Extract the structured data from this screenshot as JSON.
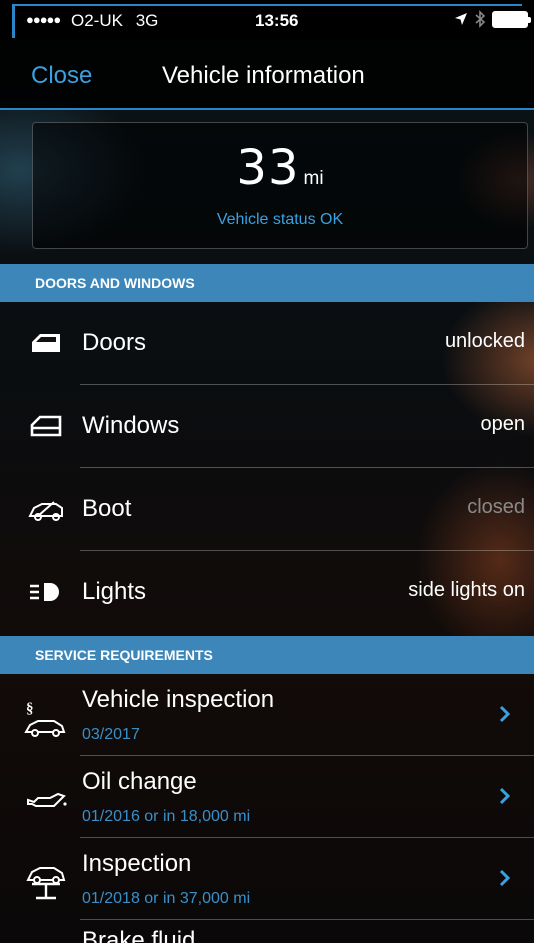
{
  "status_bar": {
    "signal_dots": "●●●●●",
    "carrier": "O2-UK",
    "network": "3G",
    "time": "13:56",
    "location_icon": "location-arrow-icon",
    "bluetooth_icon": "bluetooth-icon",
    "battery_icon": "battery-icon"
  },
  "nav": {
    "close_label": "Close",
    "title": "Vehicle information"
  },
  "vehicle_status": {
    "mileage": "33",
    "unit": "mi",
    "status": "Vehicle status OK"
  },
  "doors_windows": {
    "header": "DOORS AND WINDOWS",
    "items": [
      {
        "icon": "door-icon",
        "label": "Doors",
        "value": "unlocked"
      },
      {
        "icon": "window-icon",
        "label": "Windows",
        "value": "open"
      },
      {
        "icon": "boot-icon",
        "label": "Boot",
        "value": "closed"
      },
      {
        "icon": "lights-icon",
        "label": "Lights",
        "value": "side lights on"
      }
    ]
  },
  "service": {
    "header": "SERVICE REQUIREMENTS",
    "items": [
      {
        "icon": "vehicle-inspection-icon",
        "label": "Vehicle inspection",
        "sub": "03/2017",
        "section_mark": "§"
      },
      {
        "icon": "oil-can-icon",
        "label": "Oil change",
        "sub": "01/2016 or in 18,000 mi"
      },
      {
        "icon": "car-lift-icon",
        "label": "Inspection",
        "sub": "01/2018 or in 37,000 mi"
      },
      {
        "label": "Brake fluid"
      }
    ]
  },
  "colors": {
    "accent": "#2b86c7",
    "link": "#3aa0e0",
    "section_header": "#3d86b9",
    "dim_value": "#8a8a8a"
  }
}
